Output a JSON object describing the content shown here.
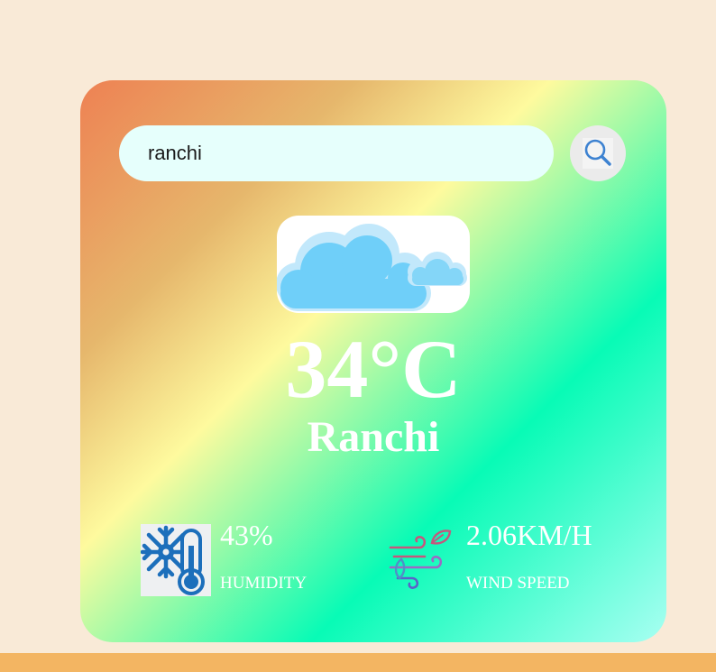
{
  "search": {
    "value": "ranchi",
    "icon": "search-icon"
  },
  "weather": {
    "icon": "cloud-icon",
    "temperature": "34°C",
    "city": "Ranchi"
  },
  "details": {
    "humidity": {
      "icon": "humidity-thermometer-icon",
      "value": "43%",
      "label": "HUMIDITY"
    },
    "wind": {
      "icon": "wind-icon",
      "value": "2.06KM/H",
      "label": "WIND SPEED"
    }
  },
  "colors": {
    "page_background": "#f9ead7",
    "bottom_bar": "#f3b562",
    "card_gradient": [
      "#ee8153",
      "#e6b76c",
      "#fefa9e",
      "#08fbb6",
      "#a8fff2"
    ],
    "search_field": "#e6fffc",
    "search_button": "#ebebeb",
    "text": "#ffffff"
  }
}
